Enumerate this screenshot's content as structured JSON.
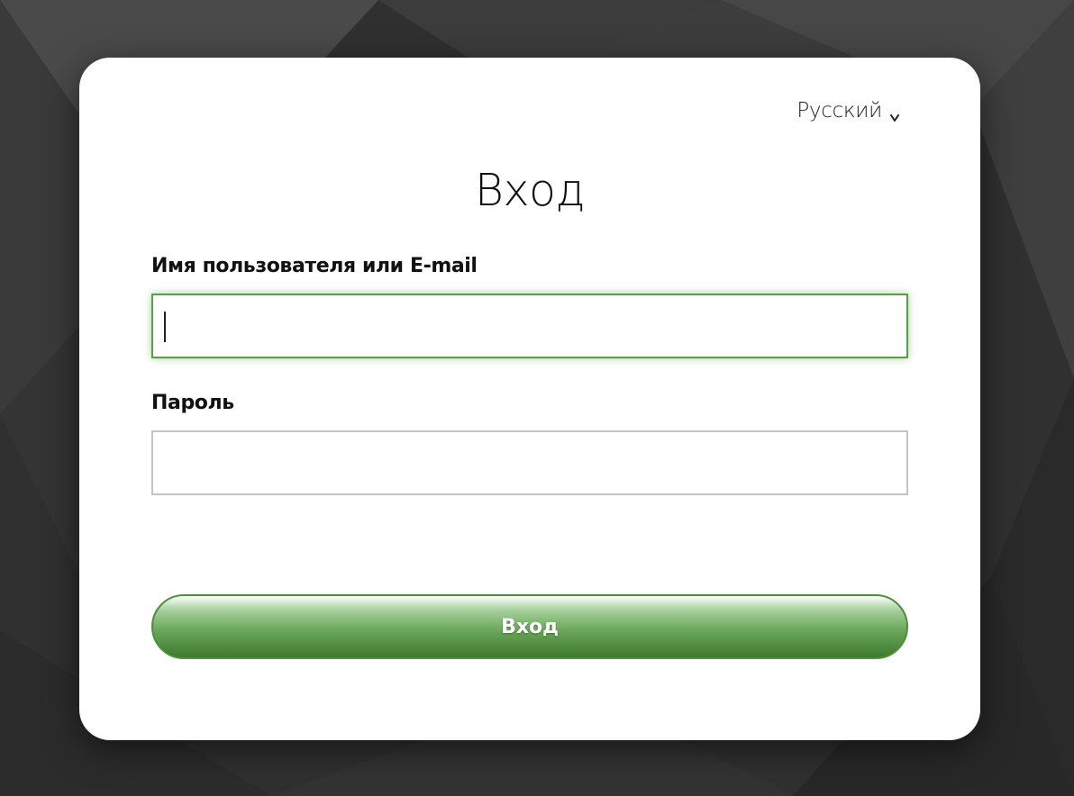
{
  "language_selector": {
    "label": "Русский"
  },
  "login_form": {
    "title": "Вход",
    "username": {
      "label": "Имя пользователя или E-mail",
      "value": "",
      "placeholder": ""
    },
    "password": {
      "label": "Пароль",
      "value": "",
      "placeholder": ""
    },
    "submit_label": "Вход"
  },
  "icons": {
    "language_dropdown": "chevron-down-icon"
  },
  "colors": {
    "accent_green": "#5b9c49",
    "button_dark_green": "#3d7a2e",
    "background_dark": "#2e2e2e",
    "card_background": "#ffffff"
  }
}
